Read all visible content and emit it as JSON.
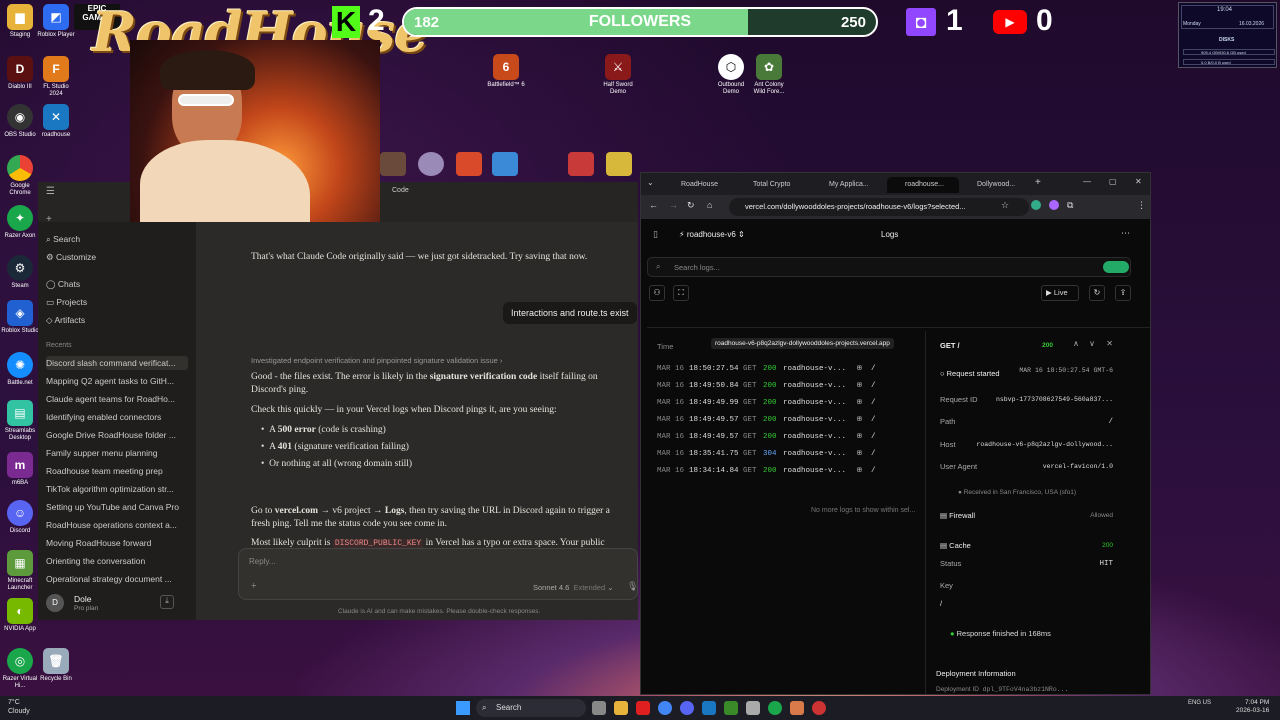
{
  "overlay": {
    "logo": "RoadHouse",
    "kick_count": "2",
    "twitch_count": "1",
    "youtube_count": "0",
    "followers_label": "FOLLOWERS",
    "followers_current": "182",
    "followers_goal": "250",
    "followers_progress": 0.728,
    "colors": {
      "kick": "#53fc18",
      "twitch": "#9146ff",
      "youtube": "#ff0000",
      "bar_fill": "#7bd88a"
    }
  },
  "desktop_icons_left": [
    "Staging",
    "Roblox Player",
    "Diablo III",
    "FL Studio 2024",
    "OBS Studio",
    "roadhouse",
    "Google Chrome",
    "Razer Axon",
    "Steam",
    "Roblox Studio",
    "Battle.net",
    "Streamlabs Desktop",
    "m6BA",
    "Discord",
    "Minecraft Launcher",
    "NVIDIA App",
    "Razer Virtual Hi...",
    "Recycle Bin"
  ],
  "desktop_icons_middle": [
    "Battlefield™ 6",
    "Half Sword Demo",
    "Outbound Demo",
    "Ant Colony Wild Fore..."
  ],
  "stats_widget": {
    "day": "Monday",
    "time": "19:04",
    "date": "16.03.2026",
    "disks_title": "DISKS",
    "disk1": "905.4 GB/930.6 GB used",
    "disk2": "0.0 B/0.0 B used"
  },
  "claude": {
    "tab_label": "Code",
    "sidebar": {
      "search": "Search",
      "customize": "Customize",
      "chats": "Chats",
      "projects": "Projects",
      "artifacts": "Artifacts",
      "recents_label": "Recents",
      "recents": [
        "Discord slash command verificat...",
        "Mapping Q2 agent tasks to GitH...",
        "Claude agent teams for RoadHo...",
        "Identifying enabled connectors",
        "Google Drive RoadHouse folder ...",
        "Family supper menu planning",
        "Roadhouse team meeting prep",
        "TikTok algorithm optimization str...",
        "Setting up YouTube and Canva Pro",
        "RoadHouse operations context a...",
        "Moving RoadHouse forward",
        "Orienting the conversation",
        "Operational strategy document ..."
      ],
      "user_name": "Dole",
      "user_plan": "Pro plan",
      "user_initial": "D"
    },
    "chat": {
      "line1": "That's what Claude Code originally said — we just got sidetracked. Try saving that now.",
      "user_msg": "Interactions and route.ts exist",
      "thinking": "Investigated endpoint verification and pinpointed signature validation issue  ›",
      "p1a": "Good - the files exist. The error is likely in the ",
      "p1b": "signature verification code",
      "p1c": " itself failing on",
      "p1d": "Discord's ping.",
      "p2": "Check this quickly — in your Vercel logs when Discord pings it, are you seeing:",
      "b1a": "A ",
      "b1b": "500 error",
      "b1c": " (code is crashing)",
      "b2a": "A ",
      "b2b": "401",
      "b2c": " (signature verification failing)",
      "b3": "Or nothing at all (wrong domain still)",
      "p3a": "Go to ",
      "p3b": "vercel.com",
      "p3c": " → v6 project → ",
      "p3d": "Logs",
      "p3e": ", then try saving the URL in Discord again to trigger a",
      "p3f": "fresh ping. Tell me the status code you see come in.",
      "p4a": "Most likely culprit is ",
      "p4b": "DISCORD_PUBLIC_KEY",
      "p4c": " in Vercel has a typo or extra space. Your public",
      "reply_placeholder": "Reply...",
      "model": "Sonnet 4.6",
      "mode": "Extended",
      "disclaimer": "Claude is AI and can make mistakes. Please double-check responses."
    }
  },
  "browser": {
    "tabs": [
      "RoadHouse",
      "Total Crypto",
      "My Applica...",
      "roadhouse...",
      "Dollywood..."
    ],
    "url": "vercel.com/dollywooddoles-projects/roadhouse-v6/logs?selected...",
    "project": "roadhouse-v6",
    "logs_title": "Logs",
    "search_placeholder": "Search logs...",
    "live_label": "Live",
    "time_header": "Time",
    "host_tooltip": "roadhouse-v6-p8q2azlgv-dollywooddoles-projects.vercel.app",
    "log_rows": [
      {
        "date": "MAR 16",
        "time": "18:50:27.54",
        "method": "GET",
        "status": "200",
        "host": "roadhouse-v...",
        "path": "/"
      },
      {
        "date": "MAR 16",
        "time": "18:49:50.84",
        "method": "GET",
        "status": "200",
        "host": "roadhouse-v...",
        "path": "/"
      },
      {
        "date": "MAR 16",
        "time": "18:49:49.99",
        "method": "GET",
        "status": "200",
        "host": "roadhouse-v...",
        "path": "/"
      },
      {
        "date": "MAR 16",
        "time": "18:49:49.57",
        "method": "GET",
        "status": "200",
        "host": "roadhouse-v...",
        "path": "/"
      },
      {
        "date": "MAR 16",
        "time": "18:49:49.57",
        "method": "GET",
        "status": "200",
        "host": "roadhouse-v...",
        "path": "/"
      },
      {
        "date": "MAR 16",
        "time": "18:35:41.75",
        "method": "GET",
        "status": "304",
        "host": "roadhouse-v...",
        "path": "/"
      },
      {
        "date": "MAR 16",
        "time": "18:34:14.84",
        "method": "GET",
        "status": "200",
        "host": "roadhouse-v...",
        "path": "/"
      }
    ],
    "no_more": "No more logs to show within sel...",
    "detail": {
      "method_path": "GET  /",
      "status": "200",
      "request_started": "Request started",
      "started_time": "MAR 16 18:50:27.54 GMT-6",
      "request_id_label": "Request ID",
      "request_id": "nsbvp-1773708627549-560a837...",
      "path_label": "Path",
      "path": "/",
      "host_label": "Host",
      "host": "roadhouse-v6-p8q2azlgv-dollywood...",
      "ua_label": "User Agent",
      "ua": "vercel-favicon/1.0",
      "received": "Received in San Francisco, USA (sfo1)",
      "firewall": "Firewall",
      "firewall_status": "Allowed",
      "cache": "Cache",
      "cache_code": "200",
      "status_label": "Status",
      "status_val": "HIT",
      "key_label": "Key",
      "key_val": "/",
      "finished": "Response finished in 168ms",
      "deploy_info": "Deployment Information",
      "deploy_id_label": "Deployment ID",
      "deploy_id": "dpl_9TFoV4na3bz1NRo..."
    }
  },
  "taskbar": {
    "weather_temp": "7°C",
    "weather_desc": "Cloudy",
    "search": "Search",
    "lang": "ENG US",
    "time": "7:04 PM",
    "date": "2026-03-16"
  }
}
